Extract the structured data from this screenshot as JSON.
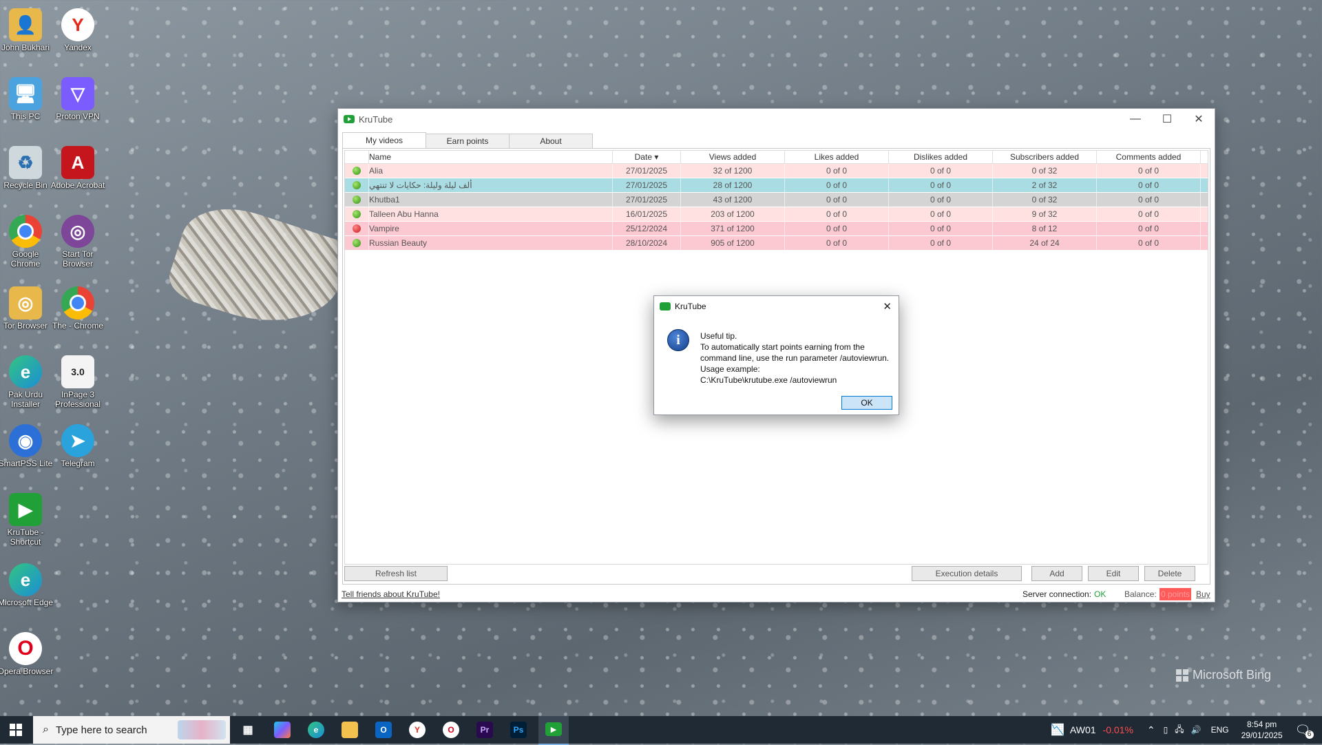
{
  "desktop_icons": [
    {
      "label": "John Bukhari",
      "icon": "user-folder-icon",
      "color": "#e8b84a"
    },
    {
      "label": "Yandex",
      "icon": "yandex-icon",
      "color": "#ffffff"
    },
    {
      "label": "This PC",
      "icon": "pc-icon",
      "color": "#4aa3df"
    },
    {
      "label": "Proton VPN",
      "icon": "protonvpn-icon",
      "color": "#7b5cff"
    },
    {
      "label": "Recycle Bin",
      "icon": "recycle-bin-icon",
      "color": "#cfd8dc"
    },
    {
      "label": "Adobe Acrobat",
      "icon": "acrobat-icon",
      "color": "#c4161c"
    },
    {
      "label": "Google Chrome",
      "icon": "chrome-icon",
      "color": "#4285f4"
    },
    {
      "label": "Start Tor Browser",
      "icon": "tor-icon",
      "color": "#7d4698"
    },
    {
      "label": "Tor Browser",
      "icon": "tor-folder-icon",
      "color": "#e8b84a"
    },
    {
      "label": "The - Chrome",
      "icon": "chrome-profile-icon",
      "color": "#4285f4"
    },
    {
      "label": "Pak Urdu Installer",
      "icon": "edge-icon",
      "color": "#1b8ed6"
    },
    {
      "label": "InPage 3 Professional",
      "icon": "inpage-icon",
      "color": "#f4f4f4"
    },
    {
      "label": "SmartPSS Lite",
      "icon": "smartpss-icon",
      "color": "#2c6fd6"
    },
    {
      "label": "Telegram",
      "icon": "telegram-icon",
      "color": "#2aa3dd"
    },
    {
      "label": "KruTube - Shortcut",
      "icon": "krutube-icon",
      "color": "#21a038"
    },
    {
      "label": "Microsoft Edge",
      "icon": "edge-icon",
      "color": "#1b8ed6"
    },
    {
      "label": "Opera Browser",
      "icon": "opera-icon",
      "color": "#e0001b"
    }
  ],
  "window": {
    "title": "KruTube",
    "tabs": [
      "My videos",
      "Earn points",
      "About"
    ],
    "columns": [
      "Name",
      "Date ▾",
      "Views added",
      "Likes added",
      "Dislikes added",
      "Subscribers added",
      "Comments added"
    ],
    "rows": [
      {
        "status": "green",
        "bg": "pink",
        "name": "Alia",
        "date": "27/01/2025",
        "views": "32 of 1200",
        "likes": "0 of 0",
        "dislikes": "0 of 0",
        "subs": "0 of 32",
        "comments": "0 of 0"
      },
      {
        "status": "green",
        "bg": "teal",
        "name": "ألف ليلة وليلة: حكايات لا تنتهي",
        "date": "27/01/2025",
        "views": "28 of 1200",
        "likes": "0 of 0",
        "dislikes": "0 of 0",
        "subs": "2 of 32",
        "comments": "0 of 0"
      },
      {
        "status": "green",
        "bg": "grey",
        "name": "Khutba1",
        "date": "27/01/2025",
        "views": "43 of 1200",
        "likes": "0 of 0",
        "dislikes": "0 of 0",
        "subs": "0 of 32",
        "comments": "0 of 0"
      },
      {
        "status": "green",
        "bg": "pink",
        "name": "Talleen Abu Hanna",
        "date": "16/01/2025",
        "views": "203 of 1200",
        "likes": "0 of 0",
        "dislikes": "0 of 0",
        "subs": "9 of 32",
        "comments": "0 of 0"
      },
      {
        "status": "red",
        "bg": "rose",
        "name": "Vampire",
        "date": "25/12/2024",
        "views": "371 of 1200",
        "likes": "0 of 0",
        "dislikes": "0 of 0",
        "subs": "8 of 12",
        "comments": "0 of 0"
      },
      {
        "status": "green",
        "bg": "rose",
        "name": "Russian Beauty",
        "date": "28/10/2024",
        "views": "905 of 1200",
        "likes": "0 of 0",
        "dislikes": "0 of 0",
        "subs": "24 of 24",
        "comments": "0 of 0"
      }
    ],
    "buttons": {
      "refresh": "Refresh list",
      "execution": "Execution details",
      "add": "Add",
      "edit": "Edit",
      "delete": "Delete"
    },
    "status": {
      "tell_friends": "Tell friends about KruTube!",
      "server_label": "Server connection:",
      "server_value": "OK",
      "balance_label": "Balance:",
      "balance_value": "0 points",
      "buy": "Buy"
    }
  },
  "dialog": {
    "title": "KruTube",
    "lines": [
      "Useful tip.",
      "To automatically start points earning from the command line, use the run parameter /autoviewrun.",
      "Usage example:",
      "C:\\KruTube\\krutube.exe /autoviewrun"
    ],
    "ok": "OK"
  },
  "watermark": "Microsoft Bing",
  "taskbar": {
    "search_placeholder": "Type here to search",
    "apps": [
      "task-view-icon",
      "copilot-icon",
      "edge-icon",
      "file-explorer-icon",
      "outlook-icon",
      "yandex-icon",
      "opera-icon",
      "premiere-icon",
      "photoshop-icon",
      "krutube-icon"
    ],
    "apps_text": {
      "premiere": "Pr",
      "photoshop": "Ps"
    },
    "ticker": "AW01",
    "ticker_change": "-0.01%",
    "language": "ENG",
    "time": "8:54 pm",
    "date": "29/01/2025",
    "notifications": "6"
  },
  "colors": {
    "accent_green": "#21a038",
    "ticker_red": "#ff4d4d",
    "balance_bg": "#ff5a5a"
  }
}
